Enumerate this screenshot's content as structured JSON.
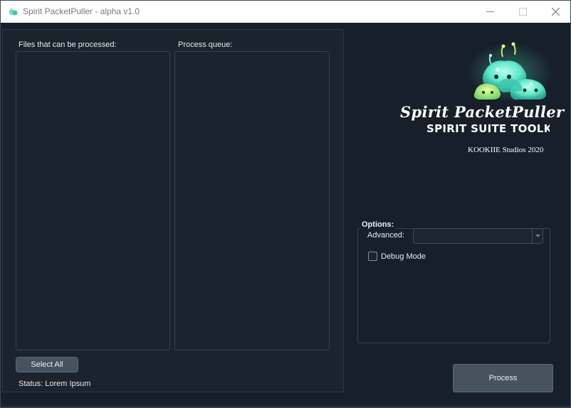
{
  "window": {
    "title": "Spirit PacketPuller - alpha v1.0"
  },
  "left_panel": {
    "files_label": "Files that can be processed:",
    "queue_label": "Process queue:",
    "files_items": [],
    "queue_items": [],
    "select_all_label": "Select All",
    "status_label": "Status:",
    "status_value": "Lorem Ipsum"
  },
  "brand": {
    "app_name": "Spirit PacketPuller",
    "suite": "SPIRIT SUITE TOOLKIT",
    "studio": "KOOKIIE Studios 2020"
  },
  "options": {
    "title": "Options:",
    "advanced_label": "Advanced:",
    "advanced_value": "",
    "debug_mode_label": "Debug Mode",
    "debug_mode_checked": false
  },
  "process_label": "Process",
  "colors": {
    "background": "#17202a",
    "panel": "#1b232d",
    "button": "#46535f",
    "logo_glow": "#5fffd0",
    "logo_accent": "#cdfb6e"
  }
}
